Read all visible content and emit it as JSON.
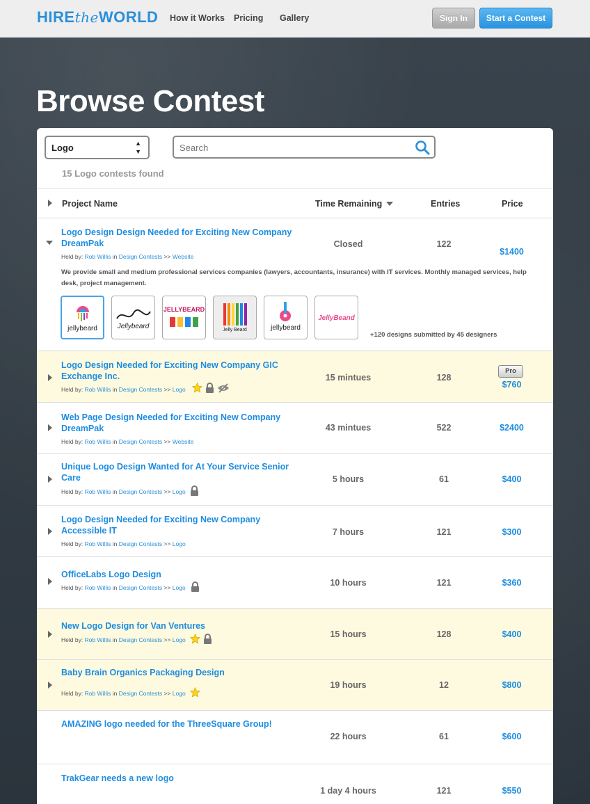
{
  "header": {
    "logo_hire": "HIRE",
    "logo_the": "the",
    "logo_world": "WORLD",
    "nav": [
      "How it Works",
      "Pricing",
      "Gallery"
    ],
    "sign_in": "Sign In",
    "start_contest": "Start a Contest"
  },
  "page_title": "Browse Contest",
  "filters": {
    "category": "Logo",
    "search_placeholder": "Search",
    "found": "15 Logo contests found"
  },
  "table": {
    "headers": [
      "Project Name",
      "Time Remaining",
      "Entries",
      "Price"
    ]
  },
  "held_by_label": "Held by:",
  "in_label": "in",
  "sep": ">>",
  "expanded": {
    "title": "Logo Design Design Needed for Exciting New Company DreamPak",
    "held_by": "Rob Willis",
    "category": "Design Contests",
    "sub": "Website",
    "time": "Closed",
    "entries": "122",
    "price": "$1400",
    "description": "We provide small and medium professional services companies (lawyers, accountants, insurance) with IT services. Monthly managed services, help desk, project management.",
    "thumb_labels": [
      "jellybeard",
      "Jellybeard",
      "JELLYBEARD",
      "Jelly Beard",
      "jellybeard",
      "JellyBeand"
    ],
    "more": "+120 designs submitted by 45 designers"
  },
  "rows": [
    {
      "title": "Logo Design Needed for Exciting New Company GIC Exchange Inc.",
      "held_by": "Rob Willis",
      "category": "Design Contests",
      "sub": "Logo",
      "time": "15 mintues",
      "entries": "128",
      "price": "$760",
      "pro": "Pro"
    },
    {
      "title": "Web Page Design Needed for Exciting New Company DreamPak",
      "held_by": "Rob Willis",
      "category": "Design Contests",
      "sub": "Website",
      "time": "43 mintues",
      "entries": "522",
      "price": "$2400"
    },
    {
      "title": "Unique Logo Design Wanted for At Your Service Senior Care",
      "held_by": "Rob Willis",
      "category": "Design Contests",
      "sub": "Logo",
      "time": "5 hours",
      "entries": "61",
      "price": "$400"
    },
    {
      "title": "Logo Design Needed for Exciting New Company Accessible IT",
      "held_by": "Rob Willis",
      "category": "Design Contests",
      "sub": "Logo",
      "time": "7 hours",
      "entries": "121",
      "price": "$300"
    },
    {
      "title": "OfficeLabs Logo Design",
      "held_by": "Rob Willis",
      "category": "Design Contests",
      "sub": "Logo",
      "time": "10 hours",
      "entries": "121",
      "price": "$360"
    },
    {
      "title": "New Logo Design for Van Ventures",
      "held_by": "Rob Willis",
      "category": "Design Contests",
      "sub": "Logo",
      "time": "15 hours",
      "entries": "128",
      "price": "$400"
    },
    {
      "title": "Baby Brain Organics Packaging Design",
      "held_by": "Rob Willis",
      "category": "Design Contests",
      "sub": "Logo",
      "time": "19 hours",
      "entries": "12",
      "price": "$800"
    },
    {
      "title": "AMAZING logo needed for the ThreeSquare Group!",
      "time": "22 hours",
      "entries": "61",
      "price": "$600"
    },
    {
      "title": "TrakGear needs a new logo",
      "time": "1 day 4 hours",
      "entries": "121",
      "price": "$550"
    }
  ]
}
